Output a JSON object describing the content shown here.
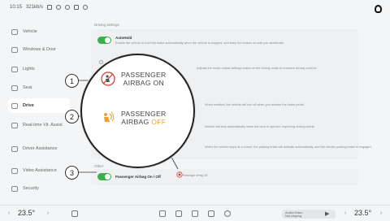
{
  "statusbar": {
    "time": "10:15",
    "signal": "321kb/s"
  },
  "sidebar": {
    "items": [
      {
        "label": "Vehicle"
      },
      {
        "label": "Windows & Door"
      },
      {
        "label": "Lights"
      },
      {
        "label": "Seat"
      },
      {
        "label": "Drive"
      },
      {
        "label": "Real-time Vit. Assist"
      },
      {
        "label": "Driver Assistance"
      },
      {
        "label": "Video Assistance"
      },
      {
        "label": "Security"
      }
    ]
  },
  "content": {
    "section_top": "Driving settings",
    "autohold_title": "AutoHold",
    "autohold_desc": "Enable the vehicle to hold the brake automatically when the vehicle is stopped, and keep the brakes on until you accelerate.",
    "desc_2": "Adjusts the motor output settings based on the driving mode to enhance driving comfort.",
    "desc_3": "When enabled, the vehicle will not roll when you release the brake pedal.",
    "desc_4": "Vehicle will stop automatically when the door is opened, improving driving safety.",
    "desc_5": "When the vehicle stops at a corner, the parking brake will activate automatically, and the electric parking brake is engaged.",
    "section_bottom": "Other",
    "airbag_setting_label": "Passenger Airbag On / Off",
    "airbag_mini_label": "Passenger Airbag Off"
  },
  "callout": {
    "airbag_on_line1": "PASSENGER",
    "airbag_on_line2": "AIRBAG ON",
    "airbag_off_line1": "PASSENGER",
    "airbag_off_line2_prefix": "AIRBAG",
    "airbag_off_line2_suffix": "OFF",
    "badge_1": "1",
    "badge_2": "2",
    "badge_3": "3"
  },
  "bottombar": {
    "temp_left": "23.5°",
    "temp_right": "23.5°",
    "media_title": "Audio/Video",
    "media_sub": "Not playing"
  },
  "colors": {
    "toggle_on": "#3dae49",
    "airbag_off": "#f0a030",
    "airbag_icon_red": "#d03a2a"
  }
}
